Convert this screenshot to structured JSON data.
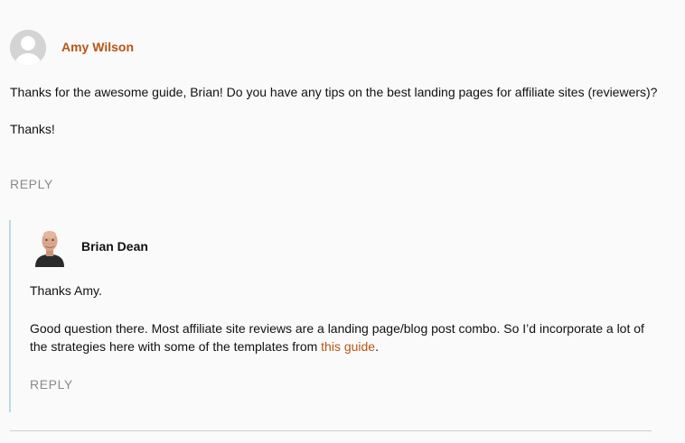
{
  "comment": {
    "author": "Amy Wilson",
    "paragraphs": [
      "Thanks for the awesome guide, Brian! Do you have any tips on the best landing pages for affiliate sites (reviewers)?",
      "Thanks!"
    ],
    "reply_label": "REPLY"
  },
  "reply": {
    "author": "Brian Dean",
    "paragraph1": "Thanks Amy.",
    "paragraph2_before": "Good question there. Most affiliate site reviews are a landing page/blog post combo. So I’d incorporate a lot of the strategies here with some of the templates from ",
    "paragraph2_link": "this guide",
    "paragraph2_after": ".",
    "reply_label": "REPLY"
  },
  "colors": {
    "accent": "#b95412",
    "reply_border": "#b8dce4",
    "muted": "#8a8a8a",
    "background": "#fafafa"
  },
  "icons": {
    "default_avatar": "default-avatar-icon",
    "author_photo": "author-photo"
  }
}
